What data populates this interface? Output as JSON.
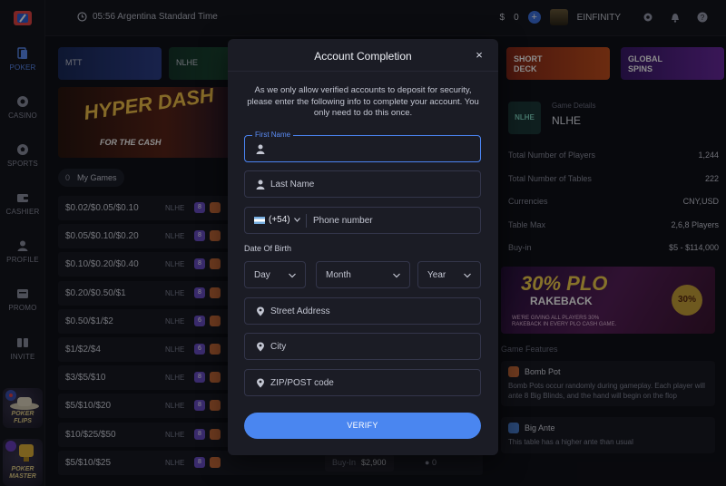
{
  "sidebar": {
    "items": [
      {
        "label": "POKER",
        "icon": "poker-icon"
      },
      {
        "label": "CASINO",
        "icon": "casino-chip-icon"
      },
      {
        "label": "SPORTS",
        "icon": "soccer-ball-icon"
      },
      {
        "label": "CASHIER",
        "icon": "wallet-icon"
      },
      {
        "label": "PROFILE",
        "icon": "user-icon"
      },
      {
        "label": "PROMO",
        "icon": "megaphone-icon"
      },
      {
        "label": "INVITE",
        "icon": "invite-icon"
      }
    ],
    "promos": [
      {
        "label": "POKER FLIPS"
      },
      {
        "label": "POKER MASTER"
      }
    ]
  },
  "topbar": {
    "time": "05:56 Argentina Standard Time",
    "balance_symbol": "$",
    "balance": "0",
    "add_label": "+",
    "username": "EINFINITY"
  },
  "lobby": {
    "tiles": [
      "MTT",
      "NLHE"
    ],
    "hero": {
      "title": "HYPER DASH",
      "subtitle": "FOR THE CASH"
    },
    "my_games_count": "0",
    "my_games_label": "My Games",
    "rows": [
      {
        "stakes": "$0.02/$0.05/$0.10",
        "type": "NLHE",
        "seats": "8"
      },
      {
        "stakes": "$0.05/$0.10/$0.20",
        "type": "NLHE",
        "seats": "8"
      },
      {
        "stakes": "$0.10/$0.20/$0.40",
        "type": "NLHE",
        "seats": "8"
      },
      {
        "stakes": "$0.20/$0.50/$1",
        "type": "NLHE",
        "seats": "8"
      },
      {
        "stakes": "$0.50/$1/$2",
        "type": "NLHE",
        "seats": "6"
      },
      {
        "stakes": "$1/$2/$4",
        "type": "NLHE",
        "seats": "6"
      },
      {
        "stakes": "$3/$5/$10",
        "type": "NLHE",
        "seats": "8"
      },
      {
        "stakes": "$5/$10/$20",
        "type": "NLHE",
        "seats": "8"
      },
      {
        "stakes": "$10/$25/$50",
        "type": "NLHE",
        "seats": "8"
      },
      {
        "stakes": "$5/$10/$25",
        "type": "NLHE",
        "seats": "8",
        "buyin_label": "Buy-In",
        "buyin": "$2,900",
        "players": "0"
      }
    ]
  },
  "right_panel": {
    "tiles": [
      {
        "label": "SHORT DECK"
      },
      {
        "label": "GLOBAL SPINS"
      }
    ],
    "game_details_caption": "Game Details",
    "game_name": "NLHE",
    "logo_text": "NLHE",
    "stats": [
      {
        "label": "Total Number of Players",
        "value": "1,244"
      },
      {
        "label": "Total Number of Tables",
        "value": "222"
      },
      {
        "label": "Currencies",
        "value": "CNY,USD"
      },
      {
        "label": "Table Max",
        "value": "2,6,8 Players"
      },
      {
        "label": "Buy-in",
        "value": "$5 - $114,000"
      }
    ],
    "banner": {
      "title": "30% PLO",
      "subtitle": "RAKEBACK",
      "fine_print": "WE'RE GIVING ALL PLAYERS 30% RAKEBACK IN EVERY PLO CASH GAME.",
      "badge": "30%"
    },
    "features_title": "Game Features",
    "features": [
      {
        "title": "Bomb Pot",
        "desc": "Bomb Pots occur randomly during gameplay. Each player will ante 8 Big Blinds, and the hand will begin on the flop"
      },
      {
        "title": "Big Ante",
        "desc": "This table has a higher ante than usual"
      }
    ]
  },
  "modal": {
    "title": "Account Completion",
    "close_label": "×",
    "description": "As we only allow verified accounts to deposit for security, please enter the following info to complete your account. You only need to do this once.",
    "first_name_label": "First Name",
    "last_name_placeholder": "Last Name",
    "phone_prefix": "(+54)",
    "phone_placeholder": "Phone number",
    "dob_label": "Date Of Birth",
    "day_label": "Day",
    "month_label": "Month",
    "year_label": "Year",
    "street_placeholder": "Street Address",
    "city_placeholder": "City",
    "zip_placeholder": "ZIP/POST code",
    "verify_label": "VERIFY"
  },
  "colors": {
    "accent": "#4a86f0",
    "background": "#101118",
    "modal_bg": "#1b1c25"
  }
}
